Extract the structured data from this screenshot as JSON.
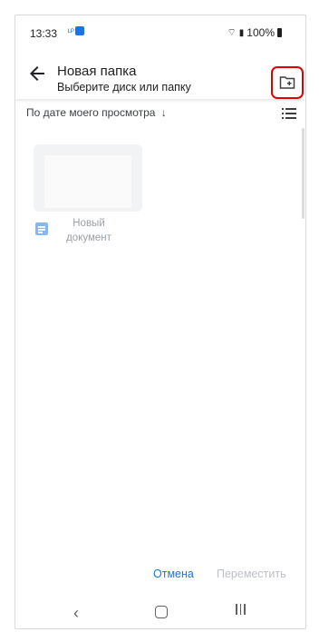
{
  "status": {
    "time": "13:33",
    "battery": "100%"
  },
  "appbar": {
    "title": "Новая папка",
    "subtitle": "Выберите диск или папку"
  },
  "sort": {
    "label": "По дате моего просмотра",
    "arrow": "↓"
  },
  "file": {
    "name": "Новый документ"
  },
  "actions": {
    "cancel": "Отмена",
    "move": "Переместить"
  },
  "icons": {
    "back": "arrow-left-icon",
    "new_folder": "new-folder-icon",
    "list_view": "list-view-icon",
    "document": "document-icon"
  },
  "colors": {
    "accent": "#1a73e8",
    "highlight": "#e00000",
    "doc": "#8ab4f8"
  }
}
